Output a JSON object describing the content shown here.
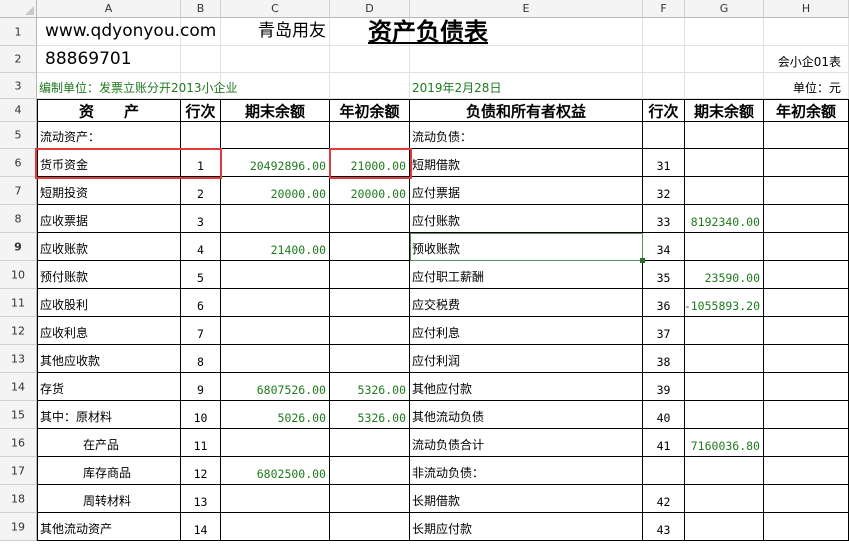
{
  "column_headers": [
    "A",
    "B",
    "C",
    "D",
    "E",
    "F",
    "G",
    "H"
  ],
  "row_headers": [
    "1",
    "2",
    "3",
    "4",
    "5",
    "6",
    "7",
    "8",
    "9",
    "10",
    "11",
    "12",
    "13",
    "14",
    "15",
    "16",
    "17",
    "18",
    "19"
  ],
  "watermark_site": "www.qdyonyou.com",
  "watermark_name": "青岛用友",
  "phone": "88869701",
  "title": "资产负债表",
  "form_code": "会小企01表",
  "compiler": "编制单位：发票立账分开2013小企业",
  "report_date": "2019年2月28日",
  "unit": "单位：元",
  "headers": {
    "asset": "资　　产",
    "line_no": "行次",
    "end_balance": "期末余额",
    "begin_balance": "年初余额",
    "liab_equity": "负债和所有者权益",
    "line_no2": "行次",
    "end_balance2": "期末余额",
    "begin_balance2": "年初余额"
  },
  "rows": [
    {
      "a": "流动资产：",
      "b": "",
      "c": "",
      "d": "",
      "e": "流动负债：",
      "f": "",
      "g": "",
      "h": ""
    },
    {
      "a": "货币资金",
      "b": "1",
      "c": "20492896.00",
      "d": "21000.00",
      "e": "短期借款",
      "f": "31",
      "g": "",
      "h": ""
    },
    {
      "a": "短期投资",
      "b": "2",
      "c": "20000.00",
      "d": "20000.00",
      "e": "应付票据",
      "f": "32",
      "g": "",
      "h": ""
    },
    {
      "a": "应收票据",
      "b": "3",
      "c": "",
      "d": "",
      "e": "应付账款",
      "f": "33",
      "g": "8192340.00",
      "h": ""
    },
    {
      "a": "应收账款",
      "b": "4",
      "c": "21400.00",
      "d": "",
      "e": "预收账款",
      "f": "34",
      "g": "",
      "h": ""
    },
    {
      "a": "预付账款",
      "b": "5",
      "c": "",
      "d": "",
      "e": "应付职工薪酬",
      "f": "35",
      "g": "23590.00",
      "h": ""
    },
    {
      "a": "应收股利",
      "b": "6",
      "c": "",
      "d": "",
      "e": "应交税费",
      "f": "36",
      "g": "-1055893.20",
      "h": ""
    },
    {
      "a": "应收利息",
      "b": "7",
      "c": "",
      "d": "",
      "e": "应付利息",
      "f": "37",
      "g": "",
      "h": ""
    },
    {
      "a": "其他应收款",
      "b": "8",
      "c": "",
      "d": "",
      "e": "应付利润",
      "f": "38",
      "g": "",
      "h": ""
    },
    {
      "a": "存货",
      "b": "9",
      "c": "6807526.00",
      "d": "5326.00",
      "e": "其他应付款",
      "f": "39",
      "g": "",
      "h": ""
    },
    {
      "a": "其中：原材料",
      "b": "10",
      "c": "5026.00",
      "d": "5326.00",
      "e": "其他流动负债",
      "f": "40",
      "g": "",
      "h": ""
    },
    {
      "a": "在产品",
      "b": "11",
      "c": "",
      "d": "",
      "e": "流动负债合计",
      "f": "41",
      "g": "7160036.80",
      "h": ""
    },
    {
      "a": "库存商品",
      "b": "12",
      "c": "6802500.00",
      "d": "",
      "e": "非流动负债：",
      "f": "",
      "g": "",
      "h": ""
    },
    {
      "a": "周转材料",
      "b": "13",
      "c": "",
      "d": "",
      "e": "长期借款",
      "f": "42",
      "g": "",
      "h": ""
    },
    {
      "a": "其他流动资产",
      "b": "14",
      "c": "",
      "d": "",
      "e": "长期应付款",
      "f": "43",
      "g": "",
      "h": ""
    }
  ],
  "colors": {
    "green_text": "#1f7a1f",
    "highlight": "#e03a3a",
    "selection": "#5a8f5a"
  }
}
